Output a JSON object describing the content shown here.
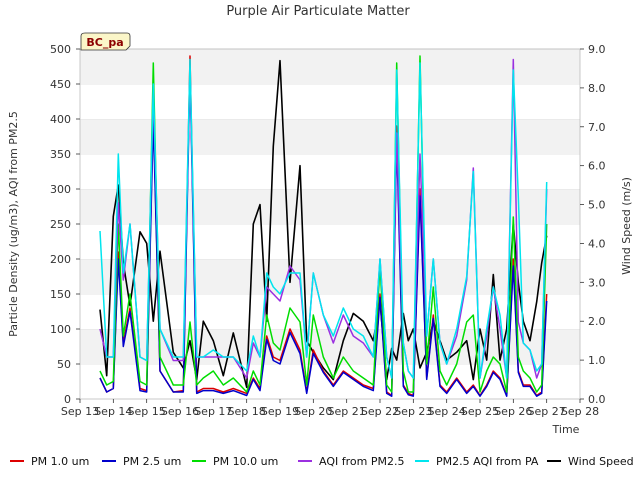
{
  "chart_data": {
    "type": "line",
    "title": "Purple Air Particulate Matter",
    "site_label": "BC_pa",
    "xlabel": "Time",
    "ylabel": "Particle Density (ug/m3), AQI from PM2.5",
    "ylabel_right": "Wind Speed (m/s)",
    "xlim": [
      13,
      28
    ],
    "ylim": [
      0,
      500
    ],
    "ylim_right": [
      0,
      9
    ],
    "x_ticks": [
      13,
      14,
      15,
      16,
      17,
      18,
      19,
      20,
      21,
      22,
      23,
      24,
      25,
      26,
      27,
      28
    ],
    "x_tick_labels": [
      "Sep 13",
      "Sep 14",
      "Sep 15",
      "Sep 16",
      "Sep 17",
      "Sep 18",
      "Sep 19",
      "Sep 20",
      "Sep 21",
      "Sep 22",
      "Sep 23",
      "Sep 24",
      "Sep 25",
      "Sep 26",
      "Sep 27",
      "Sep 28"
    ],
    "y_ticks": [
      0,
      50,
      100,
      150,
      200,
      250,
      300,
      350,
      400,
      450,
      500
    ],
    "y_tick_labels": [
      "0",
      "50",
      "100",
      "150",
      "200",
      "250",
      "300",
      "350",
      "400",
      "450",
      "500"
    ],
    "y_right_ticks": [
      0,
      1,
      2,
      3,
      4,
      5,
      6,
      7,
      8,
      9
    ],
    "y_right_tick_labels": [
      "0.0",
      "1.0",
      "2.0",
      "3.0",
      "4.0",
      "5.0",
      "6.0",
      "7.0",
      "8.0",
      "9.0"
    ],
    "grid": "horizontal bands",
    "legend_position": "bottom",
    "x": [
      13.6,
      13.8,
      14.0,
      14.15,
      14.3,
      14.5,
      14.8,
      15.0,
      15.2,
      15.4,
      15.8,
      16.1,
      16.3,
      16.5,
      16.7,
      17.0,
      17.3,
      17.6,
      18.0,
      18.2,
      18.4,
      18.6,
      18.8,
      19.0,
      19.3,
      19.6,
      19.8,
      20.0,
      20.3,
      20.6,
      20.9,
      21.2,
      21.5,
      21.8,
      22.0,
      22.2,
      22.35,
      22.5,
      22.7,
      22.85,
      23.0,
      23.2,
      23.4,
      23.6,
      23.8,
      24.0,
      24.3,
      24.6,
      24.8,
      25.0,
      25.2,
      25.4,
      25.6,
      25.8,
      26.0,
      26.15,
      26.3,
      26.5,
      26.7,
      26.85,
      27.0
    ],
    "series": [
      {
        "name": "PM 1.0 um",
        "color": "#dd0000",
        "axis": "left",
        "values": [
          30,
          10,
          15,
          210,
          80,
          130,
          15,
          12,
          415,
          40,
          10,
          12,
          490,
          10,
          15,
          15,
          10,
          15,
          8,
          30,
          15,
          90,
          60,
          55,
          100,
          70,
          10,
          70,
          40,
          20,
          40,
          30,
          20,
          15,
          150,
          10,
          5,
          390,
          20,
          8,
          5,
          300,
          30,
          120,
          20,
          10,
          30,
          10,
          20,
          5,
          20,
          40,
          30,
          5,
          200,
          40,
          20,
          20,
          5,
          10,
          150
        ]
      },
      {
        "name": "PM 2.5 um",
        "color": "#0000cc",
        "axis": "left",
        "values": [
          30,
          10,
          15,
          200,
          75,
          125,
          12,
          10,
          400,
          40,
          10,
          10,
          470,
          8,
          12,
          12,
          8,
          12,
          5,
          28,
          12,
          85,
          55,
          50,
          95,
          65,
          8,
          65,
          38,
          18,
          38,
          28,
          18,
          12,
          145,
          8,
          4,
          370,
          18,
          6,
          4,
          290,
          28,
          115,
          18,
          8,
          28,
          8,
          18,
          4,
          18,
          38,
          28,
          4,
          190,
          38,
          18,
          18,
          4,
          8,
          140
        ]
      },
      {
        "name": "PM 10.0 um",
        "color": "#00dd00",
        "axis": "left",
        "values": [
          40,
          20,
          25,
          250,
          90,
          150,
          25,
          20,
          480,
          60,
          20,
          20,
          110,
          20,
          30,
          40,
          20,
          30,
          10,
          40,
          20,
          120,
          80,
          70,
          130,
          110,
          20,
          120,
          60,
          30,
          60,
          40,
          30,
          20,
          190,
          20,
          10,
          480,
          40,
          10,
          10,
          490,
          50,
          160,
          40,
          20,
          50,
          110,
          120,
          10,
          40,
          60,
          50,
          10,
          260,
          60,
          40,
          30,
          10,
          20,
          250
        ]
      },
      {
        "name": "AQI from PM2.5",
        "color": "#9b30e0",
        "axis": "left",
        "values": [
          100,
          60,
          60,
          280,
          170,
          250,
          60,
          55,
          440,
          100,
          55,
          55,
          470,
          60,
          60,
          60,
          60,
          60,
          30,
          80,
          60,
          160,
          150,
          140,
          190,
          170,
          60,
          180,
          120,
          80,
          120,
          90,
          80,
          60,
          200,
          60,
          30,
          380,
          80,
          40,
          30,
          350,
          90,
          200,
          80,
          50,
          90,
          170,
          330,
          30,
          90,
          160,
          100,
          30,
          485,
          110,
          80,
          70,
          30,
          50,
          300
        ]
      },
      {
        "name": "PM2.5 AQI from PA",
        "color": "#00e5ee",
        "axis": "left",
        "values": [
          240,
          60,
          60,
          350,
          180,
          250,
          60,
          55,
          450,
          100,
          60,
          60,
          485,
          60,
          60,
          70,
          60,
          60,
          40,
          90,
          60,
          180,
          160,
          150,
          180,
          180,
          60,
          180,
          120,
          90,
          130,
          100,
          90,
          60,
          200,
          60,
          30,
          470,
          80,
          40,
          30,
          480,
          90,
          200,
          80,
          50,
          100,
          175,
          325,
          30,
          100,
          160,
          120,
          30,
          470,
          290,
          80,
          70,
          40,
          50,
          310
        ]
      },
      {
        "name": "Wind Speed",
        "color": "#000000",
        "axis": "right",
        "values": [
          2.3,
          0.6,
          4.7,
          5.5,
          3.5,
          2.4,
          4.3,
          4.0,
          2.0,
          3.8,
          1.2,
          0.8,
          1.5,
          0.5,
          2.0,
          1.5,
          0.6,
          1.7,
          0.3,
          4.5,
          5.0,
          2.0,
          6.5,
          8.7,
          3.0,
          6.0,
          1.5,
          1.2,
          0.8,
          0.5,
          1.5,
          2.2,
          2.0,
          1.5,
          2.5,
          0.5,
          1.3,
          1.0,
          2.2,
          1.5,
          1.8,
          0.8,
          1.2,
          2.0,
          1.5,
          1.0,
          1.2,
          1.5,
          0.5,
          1.8,
          1.0,
          3.2,
          1.0,
          1.8,
          4.5,
          3.0,
          2.0,
          1.5,
          2.5,
          3.5,
          4.2
        ]
      }
    ]
  }
}
